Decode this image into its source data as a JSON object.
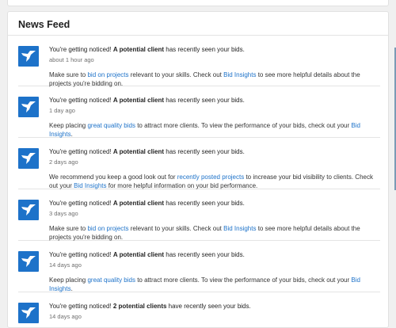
{
  "header": {
    "title": "News Feed"
  },
  "items": [
    {
      "prefix": "You're getting noticed! ",
      "client": "A potential client",
      "suffix": " has recently seen your bids.",
      "time": "about 1 hour ago",
      "d1": "Make sure to ",
      "l1": "bid on projects",
      "d2": " relevant to your skills. Check out ",
      "l2": "Bid Insights",
      "d3": " to see more helpful details about the projects you're bidding on."
    },
    {
      "prefix": "You're getting noticed! ",
      "client": "A potential client",
      "suffix": " has recently seen your bids.",
      "time": "1 day ago",
      "d1": "Keep placing ",
      "l1": "great quality bids",
      "d2": " to attract more clients. To view the performance of your bids, check out your ",
      "l2": "Bid Insights",
      "d3": "."
    },
    {
      "prefix": "You're getting noticed! ",
      "client": "A potential client",
      "suffix": " has recently seen your bids.",
      "time": "2 days ago",
      "d1": "We recommend you keep a good look out for ",
      "l1": "recently posted projects",
      "d2": " to increase your bid visibility to clients. Check out your ",
      "l2": "Bid Insights",
      "d3": " for more helpful information on your bid performance."
    },
    {
      "prefix": "You're getting noticed! ",
      "client": "A potential client",
      "suffix": " has recently seen your bids.",
      "time": "3 days ago",
      "d1": "Make sure to ",
      "l1": "bid on projects",
      "d2": " relevant to your skills. Check out ",
      "l2": "Bid Insights",
      "d3": " to see more helpful details about the projects you're bidding on."
    },
    {
      "prefix": "You're getting noticed! ",
      "client": "A potential client",
      "suffix": " has recently seen your bids.",
      "time": "14 days ago",
      "d1": "Keep placing ",
      "l1": "great quality bids",
      "d2": " to attract more clients. To view the performance of your bids, check out your ",
      "l2": "Bid Insights",
      "d3": "."
    },
    {
      "prefix": "You're getting noticed! ",
      "client": "2 potential clients",
      "suffix": " have recently seen your bids.",
      "time": "14 days ago",
      "d1": "",
      "l1": "",
      "d2": "",
      "l2": "",
      "d3": ""
    }
  ],
  "brand_color": "#1d72c9",
  "icon": "freelancer-bird-icon"
}
